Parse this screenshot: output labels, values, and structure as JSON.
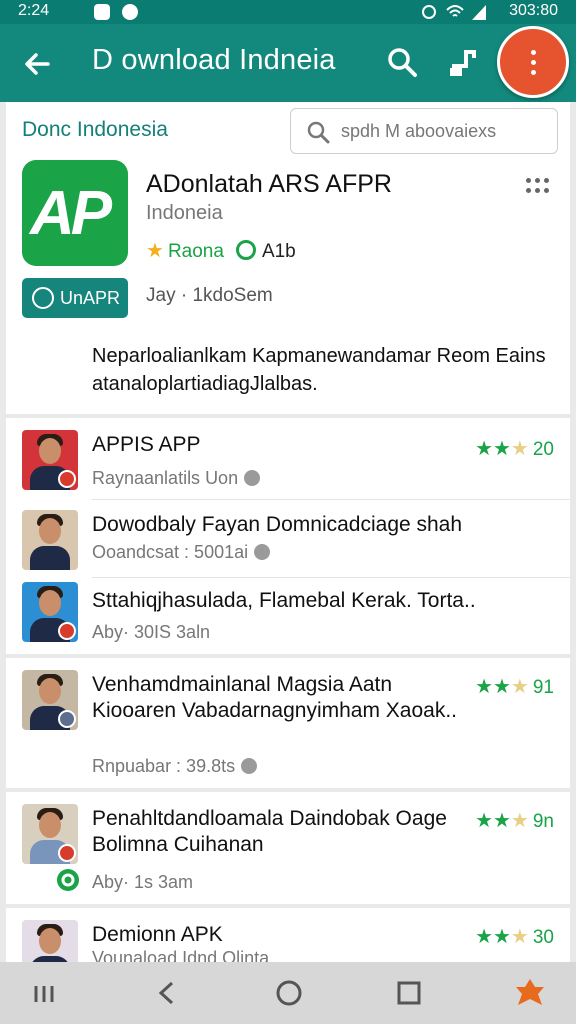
{
  "status": {
    "time": "2:24",
    "right_text": "303:80"
  },
  "appbar": {
    "title": "D ownload Indneia"
  },
  "header": {
    "store_name": "Donc Indonesia",
    "search_placeholder": "spdh M aboovaiexs",
    "app_logo_text": "AP",
    "app_name": "ADonlatah ARS AFPR",
    "developer": "Indoneia",
    "rating_label": "Raona",
    "size_label": "A1b",
    "install_label": "UnAPR",
    "meta": "Jay · 1kdoSem",
    "description": "Neparloalianlkam Kapmanewandamar Reom Eains atanaloplartiadiagJlalbas."
  },
  "rows": [
    {
      "title": "APPIS APP",
      "sub": "Raynaanlatils Uon",
      "rating_num": "20",
      "stars_filled": 2,
      "stars_total": 3
    },
    {
      "title": "Dowodbaly Fayan Domnicadciage shah",
      "sub": "Ooandcsat : 5001ai"
    },
    {
      "title": "Sttahiqjhasulada, Flamebal Kerak. Torta..",
      "sub": "Aby· 30IS 3aln"
    },
    {
      "title": "Venhamdmainlanal Magsia Aatn Kiooaren Vabadarnagnyimham Xaoak..",
      "sub": "Rnpuabar : 39.8ts",
      "rating_num": "91",
      "stars_filled": 2,
      "stars_total": 3
    },
    {
      "title": "Penahltdandloamala Daindobak Oage Bolimna Cuihanan",
      "sub": "Aby· 1s 3am",
      "rating_num": "9n",
      "stars_filled": 2,
      "stars_total": 3
    },
    {
      "title": "Demionn APK",
      "sub": "Vounaload Idnd Olinta",
      "rating_num": "30",
      "stars_filled": 2,
      "stars_total": 3
    }
  ],
  "colors": {
    "primary": "#12897c",
    "accent": "#e5532f",
    "green": "#1aa347"
  },
  "icons": [
    "back-arrow-icon",
    "search-icon",
    "share-icon",
    "more-vert-icon",
    "star-icon",
    "check-circle-icon"
  ]
}
